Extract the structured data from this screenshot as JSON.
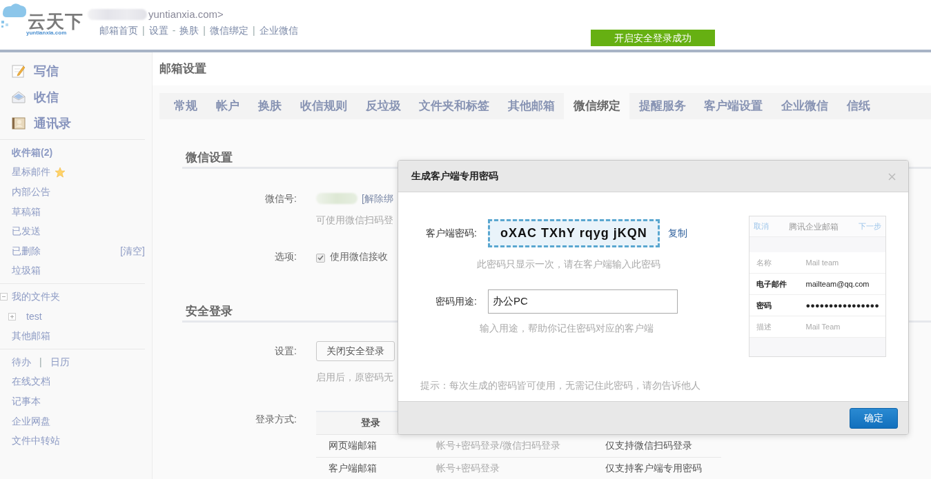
{
  "header": {
    "logo": {
      "name": "云天下",
      "domain": "yuntianxia.com"
    },
    "account": "yuntianxia.com>",
    "nav": [
      {
        "label": "邮箱首页"
      },
      {
        "label": "设置",
        "separator_before": "|"
      },
      {
        "label": "换肤",
        "separator_before": "-"
      },
      {
        "label": "微信绑定",
        "separator_before": "|"
      },
      {
        "label": "企业微信",
        "separator_before": "|"
      }
    ],
    "notice": "开启安全登录成功"
  },
  "sidebar": {
    "actions": [
      {
        "label": "写信",
        "kind": "compose"
      },
      {
        "label": "收信",
        "kind": "inbox"
      },
      {
        "label": "通讯录",
        "kind": "contacts"
      }
    ],
    "folders": [
      {
        "label": "收件箱(2)",
        "kind": "unread"
      },
      {
        "label": "星标邮件",
        "kind": "starred"
      },
      {
        "label": "内部公告",
        "kind": "plain"
      },
      {
        "label": "草稿箱",
        "kind": "plain"
      },
      {
        "label": "已发送",
        "kind": "plain"
      },
      {
        "label": "已删除",
        "kind": "action",
        "action": "[清空]"
      },
      {
        "label": "垃圾箱",
        "kind": "plain"
      }
    ],
    "my_folders": {
      "label": "我的文件夹",
      "expanded": true,
      "children": [
        {
          "label": "test",
          "expanded": false
        }
      ]
    },
    "other": "其他邮箱",
    "tools": [
      {
        "label": "待办"
      },
      {
        "label": "日历",
        "separator_before": "|"
      }
    ],
    "apps": [
      "在线文档",
      "记事本",
      "企业网盘",
      "文件中转站"
    ]
  },
  "page_title": "邮箱设置",
  "tabs": [
    {
      "label": "常规",
      "selected": false
    },
    {
      "label": "帐户",
      "selected": false
    },
    {
      "label": "换肤",
      "selected": false
    },
    {
      "label": "收信规则",
      "selected": false
    },
    {
      "label": "反垃圾",
      "selected": false
    },
    {
      "label": "文件夹和标签",
      "selected": false
    },
    {
      "label": "其他邮箱",
      "selected": false
    },
    {
      "label": "微信绑定",
      "selected": true
    },
    {
      "label": "提醒服务",
      "selected": false
    },
    {
      "label": "客户端设置",
      "selected": false
    },
    {
      "label": "企业微信",
      "selected": false
    },
    {
      "label": "信纸",
      "selected": false
    }
  ],
  "wechat_section": {
    "title": "微信设置",
    "account_label": "微信号:",
    "unbind": "[解除绑",
    "account_hint": "可使用微信扫码登",
    "option_label": "选项:",
    "option": {
      "label": "使用微信接收",
      "checked": true
    }
  },
  "security_section": {
    "title": "安全登录",
    "setting_label": "设置:",
    "button": "关闭安全登录",
    "hint": "启用后，原密码无",
    "method_label": "登录方式:",
    "table": {
      "columns": [
        "登录"
      ],
      "rows": [
        [
          "网页端邮箱",
          "帐号+密码登录/微信扫码登录",
          "仅支持微信扫码登录"
        ],
        [
          "客户端邮箱",
          "帐号+密码登录",
          "仅支持客户端专用密码"
        ]
      ]
    }
  },
  "dialog": {
    "title": "生成客户端专用密码",
    "password_label": "客户端密码:",
    "password": "oXAC TXhY rqyg jKQN",
    "copy": "复制",
    "password_hint": "此密码只显示一次，请在客户端输入此密码",
    "purpose_label": "密码用途:",
    "purpose_value": "办公PC",
    "purpose_hint": "输入用途，帮助你记住密码对应的客户端",
    "tip": "提示：每次生成的密码皆可使用，无需记住此密码，请勿告诉他人",
    "ok": "确定",
    "preview": {
      "cancel": "取消",
      "title": "腾讯企业邮箱",
      "next": "下一步",
      "fields": [
        {
          "label": "名称",
          "value": "Mail team",
          "filled": false
        },
        {
          "label": "电子邮件",
          "value": "mailteam@qq.com",
          "filled": true
        },
        {
          "label": "密码",
          "value": "●●●●●●●●●●●●●●●●",
          "filled": true
        },
        {
          "label": "描述",
          "value": "Mail Team",
          "filled": false
        }
      ]
    }
  }
}
